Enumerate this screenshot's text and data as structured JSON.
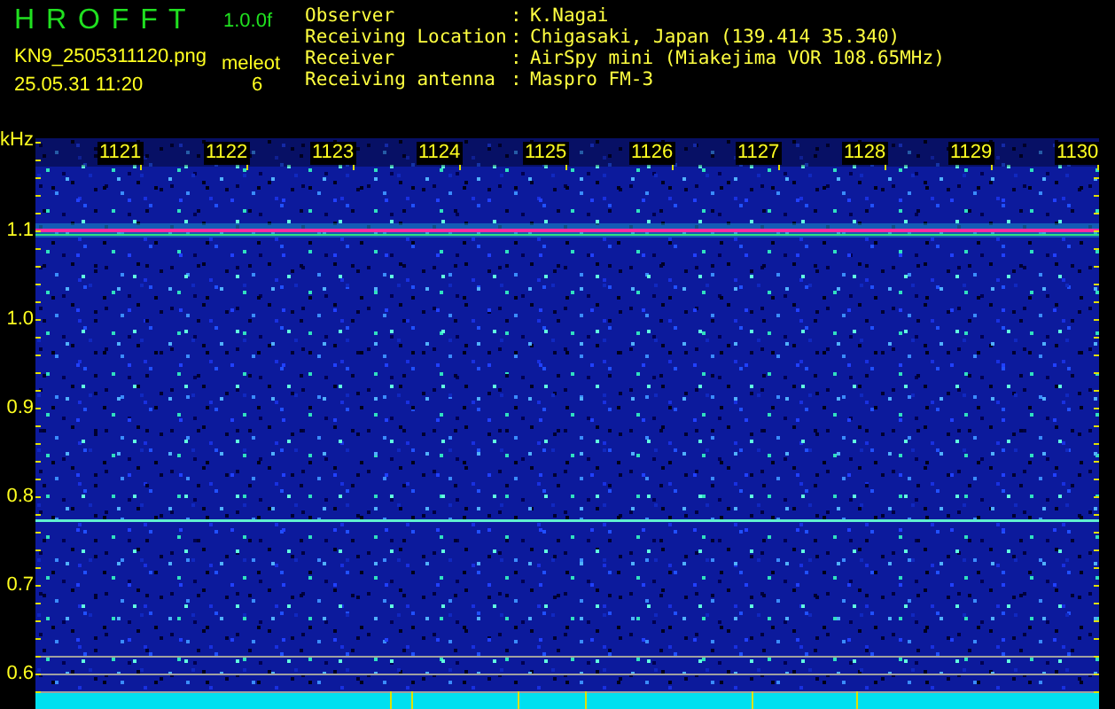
{
  "header": {
    "title": "H R O F F T",
    "version": "1.0.0f",
    "filename": "KN9_2505311120.png",
    "mode_label": "meleot",
    "datetime": "25.05.31 11:20",
    "count": "6"
  },
  "info": [
    {
      "label": "Observer",
      "sep": ":",
      "value": "K.Nagai"
    },
    {
      "label": "Receiving Location",
      "sep": ":",
      "value": "Chigasaki, Japan (139.414 35.340)"
    },
    {
      "label": "Receiver",
      "sep": ":",
      "value": "AirSpy mini (Miakejima VOR 108.65MHz)"
    },
    {
      "label": "Receiving antenna",
      "sep": ":",
      "value": "Maspro FM-3"
    }
  ],
  "spectrogram": {
    "y_unit": "kHz",
    "y_labels": [
      "1.1",
      "1.0",
      "0.9",
      "0.8",
      "0.7",
      "0.6"
    ],
    "x_labels": [
      "1121",
      "1122",
      "1123",
      "1124",
      "1125",
      "1126",
      "1127",
      "1128",
      "1129",
      "1130"
    ]
  }
}
